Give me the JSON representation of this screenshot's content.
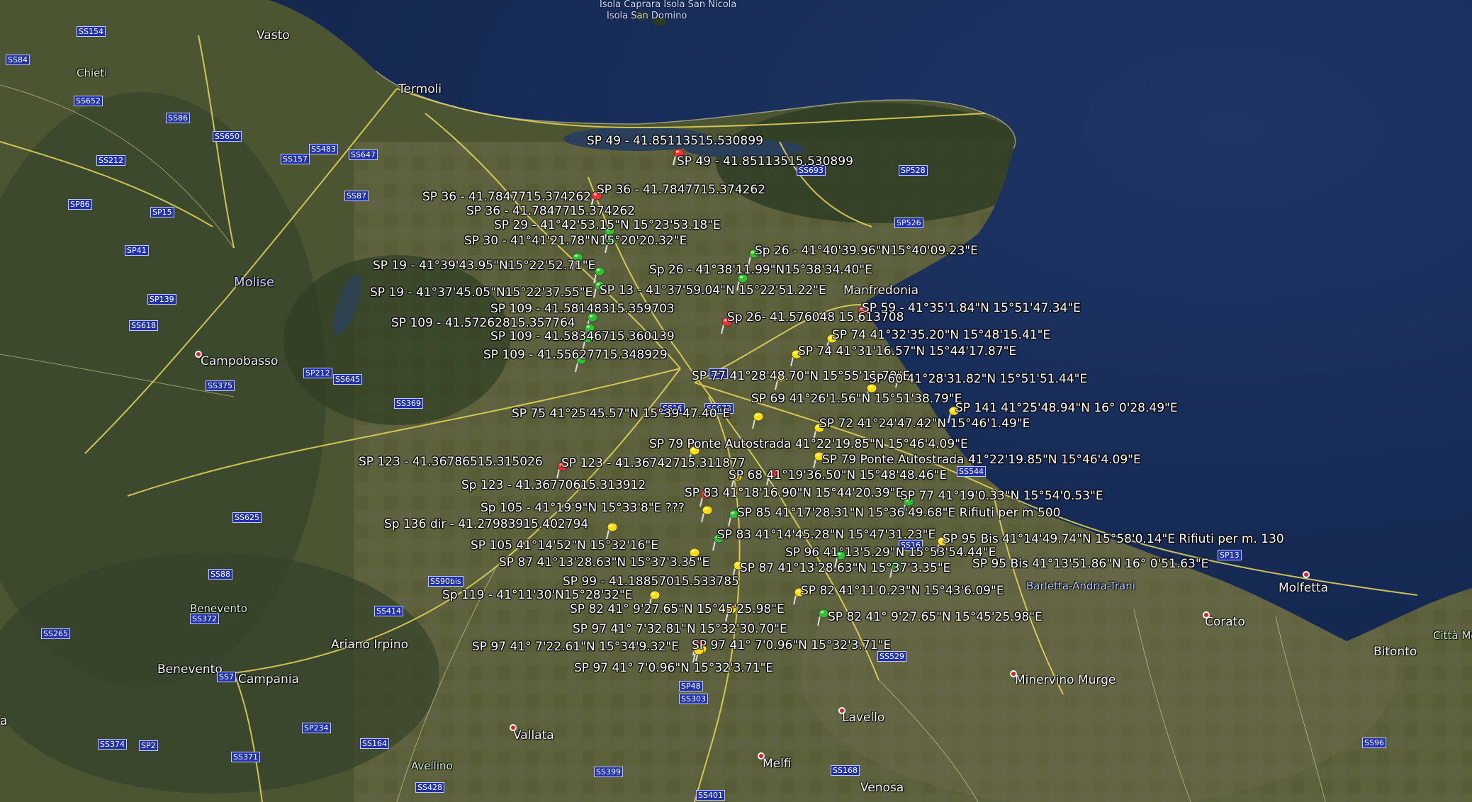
{
  "cities": [
    {
      "id": "vasto",
      "name": "Vasto"
    },
    {
      "id": "termoli",
      "name": "Termoli"
    },
    {
      "id": "manfredonia",
      "name": "Manfredonia"
    },
    {
      "id": "campobasso",
      "name": "Campobasso"
    },
    {
      "id": "molise",
      "name": "Molise"
    },
    {
      "id": "benevento",
      "name": "Benevento"
    },
    {
      "id": "campania",
      "name": "Campania"
    },
    {
      "id": "benevento_small",
      "name": "Benevento"
    },
    {
      "id": "ariano",
      "name": "Ariano Irpino"
    },
    {
      "id": "vallata",
      "name": "Vallata"
    },
    {
      "id": "melfi",
      "name": "Melfi"
    },
    {
      "id": "venosa",
      "name": "Venosa"
    },
    {
      "id": "lavello",
      "name": "Lavello"
    },
    {
      "id": "minervino",
      "name": "Minervino Murge"
    },
    {
      "id": "corato",
      "name": "Corato"
    },
    {
      "id": "molfetta",
      "name": "Molfetta"
    },
    {
      "id": "bitonto",
      "name": "Bitonto"
    },
    {
      "id": "chieti",
      "name": "Chieti"
    },
    {
      "id": "avellino",
      "name": "Avellino"
    },
    {
      "id": "bat",
      "name": "Barletta-Andria-Trani"
    },
    {
      "id": "citta_metro",
      "name": "Città Metro"
    },
    {
      "id": "edge_a",
      "name": "a"
    }
  ],
  "islands": [
    "Isola Caprara",
    "Isola San Nicola",
    "Isola San Domino"
  ],
  "shields": [
    "SS154",
    "SS84",
    "SS652",
    "SS86",
    "SS650",
    "SS212",
    "SS157",
    "SS483",
    "SS647",
    "SS87",
    "SP86",
    "SP15",
    "SP41",
    "SP139",
    "SS618",
    "SS375",
    "SP212",
    "SS645",
    "SS369",
    "SS625",
    "SS88",
    "SS90bis",
    "SS414",
    "SS372",
    "SS265",
    "SS7",
    "SP234",
    "SS374",
    "SP2",
    "SS371",
    "SS164",
    "SS428",
    "SS399",
    "SP48",
    "SS303",
    "SS401",
    "SS168",
    "SS529",
    "SS544",
    "SS693",
    "SP528",
    "SP526",
    "SS16",
    "SP13",
    "SS96",
    "SS673",
    "SS16",
    "SP1"
  ],
  "markers": [
    {
      "id": "m1",
      "text": "SP 49 - 41.85113515.530899",
      "color": "#ff3030"
    },
    {
      "id": "m2",
      "text": "SP 49 - 41.85113515.530899",
      "color": "#ff3030"
    },
    {
      "id": "m3",
      "text": "SP 36 - 41.7847715.374262",
      "color": "#ff3030"
    },
    {
      "id": "m4",
      "text": "SP 36 - 41.7847715.374262",
      "color": "#ff3030"
    },
    {
      "id": "m5",
      "text": "SP 36 - 41.7847715.374262",
      "color": "#ff3030"
    },
    {
      "id": "m6",
      "text": "SP 29 - 41°42'53.15\"N 15°23'53.18\"E",
      "color": "#30c030"
    },
    {
      "id": "m7",
      "text": "SP 30 - 41°41'21.78\"N15°20'20.32\"E",
      "color": "#30c030"
    },
    {
      "id": "m8",
      "text": "Sp 26 - 41°40'39.96\"N15°40'09.23\"E",
      "color": "#30c030"
    },
    {
      "id": "m9",
      "text": "SP 19 - 41°39'43.95\"N15°22'52.71\"E",
      "color": "#30c030"
    },
    {
      "id": "m10",
      "text": "Sp 26 - 41°38'11.99\"N15°38'34.40\"E",
      "color": "#30c030"
    },
    {
      "id": "m11",
      "text": "SP 19 - 41°37'45.05\"N15°22'37.55\"E",
      "color": "#30c030"
    },
    {
      "id": "m12",
      "text": "SP 13 - 41°37'59.04\"N 15°22'51.22\"E",
      "color": "#30c030"
    },
    {
      "id": "m13",
      "text": "SP 109 - 41.58148315.359703",
      "color": "#30c030"
    },
    {
      "id": "m14",
      "text": "SP 59 - 41°35'1.84\"N  15°51'47.34\"E",
      "color": "#ff3030"
    },
    {
      "id": "m15",
      "text": "SP 109 - 41.57262815.357764",
      "color": "#30c030"
    },
    {
      "id": "m16",
      "text": "Sp 26- 41.576048 15.613708",
      "color": "#ff3030"
    },
    {
      "id": "m17",
      "text": "SP 109 - 41.58346715.360139",
      "color": "#30c030"
    },
    {
      "id": "m18",
      "text": "SP 74 41°32'35.20\"N   15°48'15.41\"E",
      "color": "#ffe000"
    },
    {
      "id": "m19",
      "text": "SP 74  41°31'16.57\"N  15°44'17.87\"E",
      "color": "#ffe000"
    },
    {
      "id": "m20",
      "text": "SP 109 - 41.55627715.348929",
      "color": "#30c030"
    },
    {
      "id": "m21",
      "text": "SP 77 41°28'48.70\"N 15°55'11.79\"E",
      "color": "#ffe000"
    },
    {
      "id": "m22",
      "text": "SP 60   41°28'31.82\"N 15°51'51.44\"E",
      "color": "#ffe000"
    },
    {
      "id": "m23",
      "text": "SP 69   41°26'1.56\"N    15°51'38.79\"E",
      "color": "#ffe000"
    },
    {
      "id": "m24",
      "text": "SP 141  41°25'48.94\"N 16° 0'28.49\"E",
      "color": "#ffe000"
    },
    {
      "id": "m25",
      "text": "SP 75   41°25'45.57\"N   15°39'47.40\"E",
      "color": "#ffe000"
    },
    {
      "id": "m26",
      "text": "SP 72  41°24'47.42\"N   15°46'1.49\"E",
      "color": "#ffe000"
    },
    {
      "id": "m27",
      "text": "SP 79 Ponte Autostrada 41°22'19.85\"N   15°46'4.09\"E",
      "color": "#ffe000"
    },
    {
      "id": "m28",
      "text": "SP 79 Ponte Autostrada 41°22'19.85\"N   15°46'4.09\"E",
      "color": "#ffe000"
    },
    {
      "id": "m29",
      "text": "SP 123 - 41.36786515.315026",
      "color": "#ff3030"
    },
    {
      "id": "m30",
      "text": "SP 123 - 41.36742715.311877",
      "color": "#ff3030"
    },
    {
      "id": "m31",
      "text": "SP 68  41°19'36.50\"N 15°48'48.46\"E",
      "color": "#ffe000"
    },
    {
      "id": "m32",
      "text": "Sp 123 - 41.36770615.313912",
      "color": "#ff3030"
    },
    {
      "id": "m33",
      "text": "SP 83   41°18'16.90\"N  15°44'20.39\"E",
      "color": "#30c030"
    },
    {
      "id": "m34",
      "text": "SP 77  41°19'0.33\"N   15°54'0.53\"E",
      "color": "#ffe000"
    },
    {
      "id": "m35",
      "text": "Sp 105 - 41°19'9\"N 15°33'8\"E ???",
      "color": "#30c030"
    },
    {
      "id": "m36",
      "text": "SP 85  41°17'28.31\"N  15°36'49.68\"E Rifiuti per m 500",
      "color": "#ffe000"
    },
    {
      "id": "m37",
      "text": "Sp 136 dir - 41.27983915.402794",
      "color": "#30c030"
    },
    {
      "id": "m38",
      "text": "SP 83 41°14'45.28\"N    15°47'31.23\"E",
      "color": "#ffe000"
    },
    {
      "id": "m39",
      "text": "SP 95 Bis  41°14'49.74\"N   15°58'0.14\"E Rifiuti per m. 130",
      "color": "#ffe000"
    },
    {
      "id": "m40",
      "text": "SP 105   41°14'52\"N 15°32'16\"E",
      "color": "#30c030"
    },
    {
      "id": "m41",
      "text": "SP 96   41°13'5.29\"N  15°53'54.44\"E",
      "color": "#ffe000"
    },
    {
      "id": "m42",
      "text": "SP 87   41°13'28.63\"N   15°37'3.35\"E",
      "color": "#30c030"
    },
    {
      "id": "m43",
      "text": "SP 87   41°13'28.63\"N   15°37'3.35\"E",
      "color": "#ffe000"
    },
    {
      "id": "m44",
      "text": "SP 95 Bis   41°13'51.86\"N  16° 0'51.63\"E",
      "color": "#ffe000"
    },
    {
      "id": "m45",
      "text": "SP 99 - 41.18857015.533785",
      "color": "#30c030"
    },
    {
      "id": "m46",
      "text": "SP 82   41°11'0.23\"N   15°43'6.09\"E",
      "color": "#ffe000"
    },
    {
      "id": "m47",
      "text": "Sp 119 - 41°11'30'N15°28'32\"E",
      "color": "#30c030"
    },
    {
      "id": "m48",
      "text": "SP 82   41° 9'27.65\"N   15°45'25.98\"E",
      "color": "#ff3030"
    },
    {
      "id": "m49",
      "text": "SP 82   41° 9'27.65\"N   15°45'25.98\"E",
      "color": "#ffe000"
    },
    {
      "id": "m50",
      "text": "SP 97   41° 7'32.81\"N   15°32'30.70\"E",
      "color": "#ffe000"
    },
    {
      "id": "m51",
      "text": "SP 97   41° 7'22.61\"N   15°34'9.32\"E",
      "color": "#ffe000"
    },
    {
      "id": "m52",
      "text": "SP 97   41° 7'0.96\"N    15°32'3.71\"E",
      "color": "#ffe000"
    },
    {
      "id": "m53",
      "text": "SP 97   41° 7'0.96\"N    15°32'3.71\"E",
      "color": "#ffe000"
    }
  ]
}
